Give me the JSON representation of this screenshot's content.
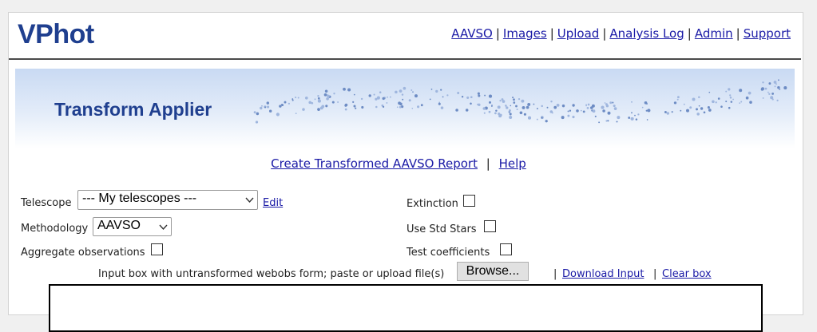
{
  "app": {
    "logo": "VPhot"
  },
  "topnav": {
    "items": [
      {
        "label": "AAVSO"
      },
      {
        "label": "Images"
      },
      {
        "label": "Upload"
      },
      {
        "label": "Analysis Log"
      },
      {
        "label": "Admin"
      },
      {
        "label": "Support"
      }
    ],
    "separator": "|"
  },
  "banner": {
    "title": "Transform Applier"
  },
  "actions": {
    "create_report": "Create Transformed AAVSO Report",
    "separator": "|",
    "help": "Help"
  },
  "form": {
    "telescope": {
      "label": "Telescope",
      "value": "--- My telescopes ---",
      "edit": "Edit"
    },
    "methodology": {
      "label": "Methodology",
      "value": "AAVSO"
    },
    "aggregate": {
      "label": "Aggregate observations",
      "checked": false
    },
    "extinction": {
      "label": "Extinction",
      "checked": false
    },
    "use_std_stars": {
      "label": "Use Std Stars",
      "checked": false
    },
    "test_coefficients": {
      "label": "Test coefficients",
      "checked": false
    },
    "input_box": {
      "label": "Input box with untransformed webobs form; paste or upload file(s)",
      "browse": "Browse...",
      "download": "Download Input",
      "clear": "Clear box",
      "separator": "|"
    }
  },
  "colors": {
    "brand": "#1f3f8f",
    "link": "#1a1aa6",
    "banner_top": "#c9daf3"
  }
}
